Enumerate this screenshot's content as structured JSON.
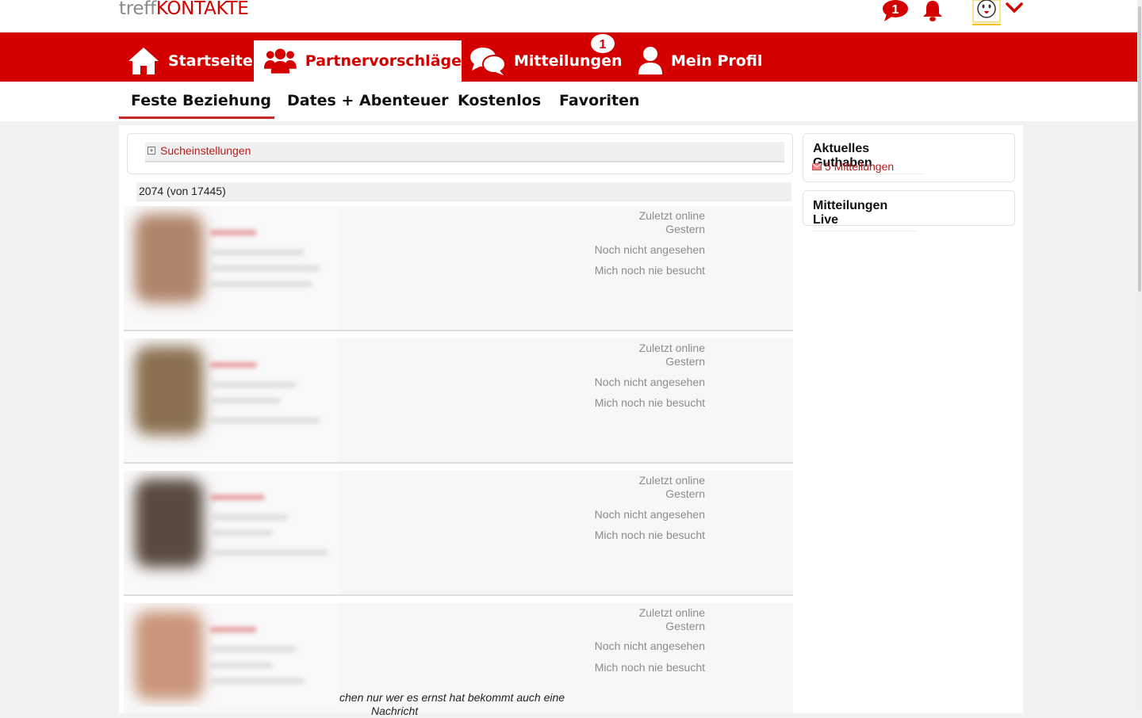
{
  "logo": {
    "part1": "treff",
    "part2": "KONTAKTE"
  },
  "header": {
    "chat_badge": "1",
    "icons": [
      "chat-bubble-icon",
      "bell-icon",
      "avatar-icon",
      "chevron-down-icon"
    ]
  },
  "nav": {
    "items": [
      {
        "label": "Startseite",
        "icon": "home-icon"
      },
      {
        "label": "Partnervorschläge",
        "icon": "users-icon"
      },
      {
        "label": "Mitteilungen",
        "icon": "chat-icon",
        "badge": "1"
      },
      {
        "label": "Mein Profil",
        "icon": "user-icon"
      }
    ],
    "active": "Partnervorschläge"
  },
  "subnav": {
    "items": [
      "Feste Beziehung",
      "Dates + Abenteuer",
      "Kostenlos",
      "Favoriten"
    ],
    "active": "Feste Beziehung"
  },
  "search": {
    "label": "Sucheinstellungen"
  },
  "results": {
    "count": "2074 (von 17445)"
  },
  "cards": [
    {
      "last_online_label": "Zuletzt online",
      "last_online_value": "Gestern",
      "viewed": "Noch nicht angesehen",
      "visited": "Mich noch nie besucht"
    },
    {
      "last_online_label": "Zuletzt online",
      "last_online_value": "Gestern",
      "viewed": "Noch nicht angesehen",
      "visited": "Mich noch nie besucht"
    },
    {
      "last_online_label": "Zuletzt online",
      "last_online_value": "Gestern",
      "viewed": "Noch nicht angesehen",
      "visited": "Mich noch nie besucht"
    },
    {
      "last_online_label": "Zuletzt online",
      "last_online_value": "Gestern",
      "viewed": "Noch nicht angesehen",
      "visited": "Mich noch nie besucht"
    }
  ],
  "bio_snippet": {
    "line1": "chen nur wer es ernst hat bekommt auch eine",
    "line2": "Nachricht"
  },
  "sidebar": {
    "credit_title": "Aktuelles Guthaben",
    "credit_link": "5 Mitteilungen",
    "live_title": "Mitteilungen Live"
  },
  "colors": {
    "brand_red": "#d40000",
    "link_red": "#b71c1c",
    "muted_text": "#8c8c8c"
  }
}
